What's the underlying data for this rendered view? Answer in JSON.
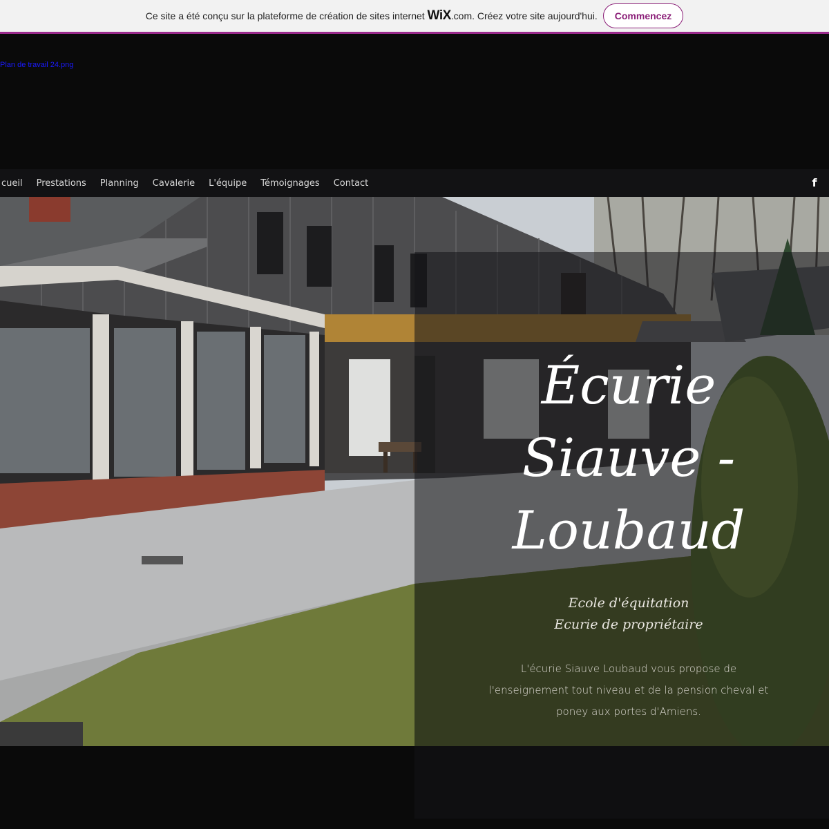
{
  "wix_banner": {
    "text_before": "Ce site a été conçu sur la plateforme de création de sites internet ",
    "logo": "WiX",
    "text_after": ".com. Créez votre site aujourd'hui.",
    "cta_label": "Commencez"
  },
  "broken_image_alt": "Plan de travail 24.png",
  "nav": {
    "items": [
      "cueil",
      "Prestations",
      "Planning",
      "Cavalerie",
      "L'équipe",
      "Témoignages",
      "Contact"
    ],
    "social_icon": "facebook-icon",
    "social_glyph": "f"
  },
  "hero": {
    "title_line1": "Écurie",
    "title_line2": "Siauve -",
    "title_line3": "Loubaud",
    "subtitle_line1": "Ecole d'équitation",
    "subtitle_line2": "Ecurie de propriétaire",
    "description": "L'écurie Siauve Loubaud vous propose de l'enseignement tout niveau et de la pension cheval et poney aux portes d'Amiens."
  },
  "colors": {
    "banner_bg": "#f2f2f2",
    "banner_border": "#9a2a8c",
    "cta": "#8b1f78",
    "page_bg": "#0a0a0a",
    "nav_bg": "#121214"
  }
}
